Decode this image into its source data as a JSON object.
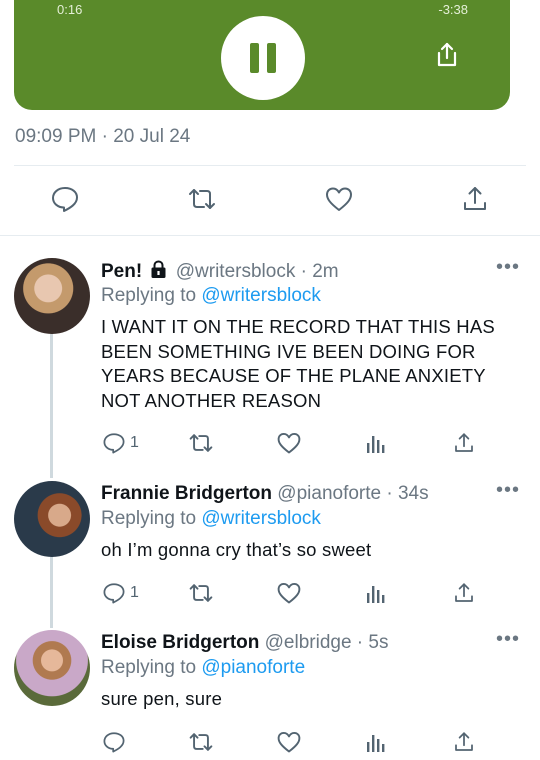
{
  "audio": {
    "elapsed": "0:16",
    "remaining": "-3:38",
    "card_color": "#5a8a2a"
  },
  "timestamp": "09:09 PM · 20 Jul 24",
  "actions": [
    "reply-icon",
    "retweet-icon",
    "like-icon",
    "share-icon"
  ],
  "replies": [
    {
      "name": "Pen!",
      "badge": "lock-icon",
      "handle": "@writersblock · 2m",
      "replying_prefix": "Replying to ",
      "replying_to": "@writersblock",
      "text": "I WANT IT ON THE RECORD THAT THIS HAS BEEN SOMETHING IVE BEEN DOING FOR YEARS BECAUSE OF THE PLANE ANXIETY NOT ANOTHER REASON",
      "reply_count": "1",
      "more": "•••"
    },
    {
      "name": "Frannie Bridgerton",
      "handle": "@pianoforte · 34s",
      "replying_prefix": "Replying to ",
      "replying_to": "@writersblock",
      "text": "oh I’m gonna cry that’s so sweet",
      "reply_count": "1",
      "more": "•••"
    },
    {
      "name": "Eloise Bridgerton",
      "handle": "@elbridge · 5s",
      "replying_prefix": "Replying to ",
      "replying_to": "@pianoforte",
      "text": "sure pen, sure",
      "reply_count": "",
      "more": "•••"
    }
  ],
  "colors": {
    "link": "#1d9bf0",
    "muted": "#6b7782",
    "divider": "#e6ecf0"
  }
}
